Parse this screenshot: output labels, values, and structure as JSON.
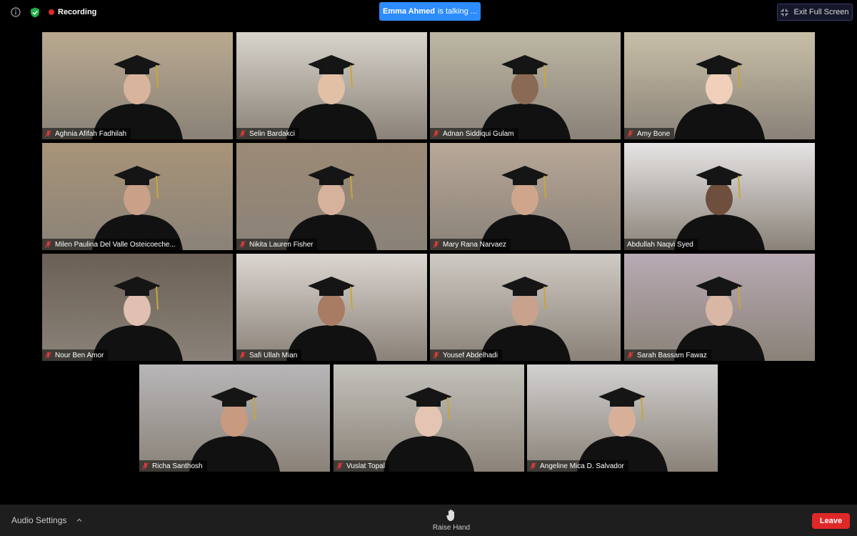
{
  "colors": {
    "recording_dot": "#e02828",
    "talking_bg": "#2d8cff",
    "leave_bg": "#e02828",
    "shield": "#22b04a",
    "muted_mic": "#e23a3a"
  },
  "topbar": {
    "info_icon": "info-icon",
    "security_icon": "shield-check-icon",
    "recording_label": "Recording",
    "talking_name": "Emma Ahmed",
    "talking_suffix": "is talking ...",
    "exit_fullscreen_label": "Exit Full Screen"
  },
  "participants": [
    {
      "name": "Aghnia Afifah Fadhilah",
      "muted": true
    },
    {
      "name": "Selin Bardakci",
      "muted": true
    },
    {
      "name": "Adnan Siddiqui Gulam",
      "muted": true
    },
    {
      "name": "Amy Bone",
      "muted": true
    },
    {
      "name": "Milen Paulina Del Valle Osteicoeche...",
      "muted": true
    },
    {
      "name": "Nikita Lauren Fisher",
      "muted": true
    },
    {
      "name": "Mary Rana Narvaez",
      "muted": true
    },
    {
      "name": "Abdullah Naqvi Syed",
      "muted": false
    },
    {
      "name": "Nour Ben Amor",
      "muted": true
    },
    {
      "name": "Safi Ullah Mian",
      "muted": true
    },
    {
      "name": "Yousef Abdelhadi",
      "muted": true
    },
    {
      "name": "Sarah Bassam Fawaz",
      "muted": true
    },
    {
      "name": "Richa Santhosh",
      "muted": true
    },
    {
      "name": "Vuslat Topal",
      "muted": true
    },
    {
      "name": "Angeline Mica D. Salvador",
      "muted": true
    }
  ],
  "bottombar": {
    "audio_settings_label": "Audio Settings",
    "raise_hand_label": "Raise Hand",
    "leave_label": "Leave"
  }
}
